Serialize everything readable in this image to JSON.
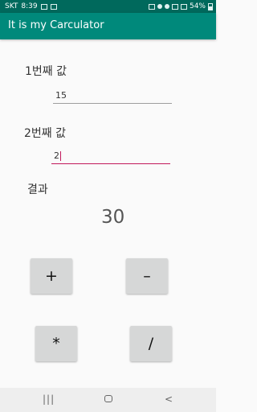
{
  "status": {
    "carrier": "SKT",
    "time": "8:39",
    "battery": "54%"
  },
  "app": {
    "title": "It is my Carculator"
  },
  "form": {
    "first_label": "1번째 값",
    "first_value": "15",
    "second_label": "2번째 값",
    "second_value": "2",
    "result_label": "결과",
    "result_value": "30"
  },
  "buttons": {
    "add": "+",
    "subtract": "–",
    "multiply": "*",
    "divide": "/"
  },
  "nav": {
    "recent": "|||",
    "back": "<"
  }
}
